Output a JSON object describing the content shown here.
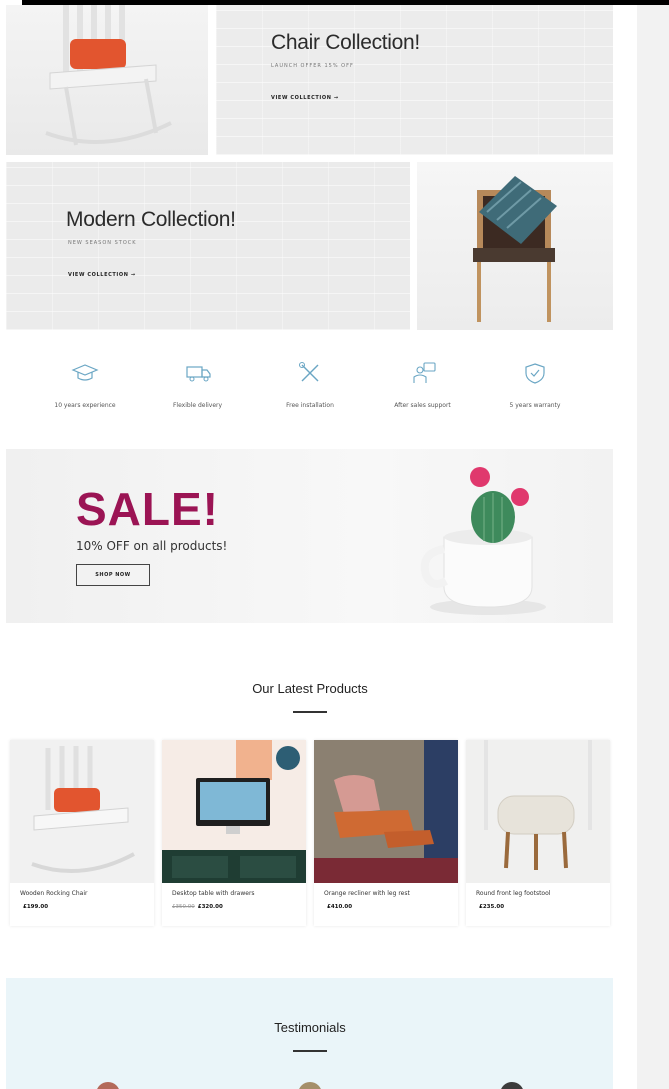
{
  "banners": {
    "chair": {
      "title": "Chair Collection!",
      "subtitle": "LAUNCH OFFER 15% OFF",
      "link": "VIEW COLLECTION"
    },
    "modern": {
      "title": "Modern Collection!",
      "subtitle": "NEW SEASON STOCK",
      "link": "VIEW COLLECTION"
    }
  },
  "features": [
    {
      "icon": "graduation-cap-icon",
      "label": "10 years experience"
    },
    {
      "icon": "truck-icon",
      "label": "Flexible delivery"
    },
    {
      "icon": "tools-icon",
      "label": "Free installation"
    },
    {
      "icon": "support-icon",
      "label": "After sales support"
    },
    {
      "icon": "shield-check-icon",
      "label": "5 years warranty"
    }
  ],
  "sale": {
    "title": "SALE!",
    "subtitle": "10% OFF on all products!",
    "button": "SHOP NOW"
  },
  "latest": {
    "title": "Our Latest Products",
    "products": [
      {
        "name": "Wooden Rocking Chair",
        "price": "£199.00",
        "old_price": ""
      },
      {
        "name": "Desktop table with drawers",
        "price": "£320.00",
        "old_price": "£350.00"
      },
      {
        "name": "Orange recliner with leg rest",
        "price": "£410.00",
        "old_price": ""
      },
      {
        "name": "Round front leg footstool",
        "price": "£235.00",
        "old_price": ""
      }
    ]
  },
  "testimonials": {
    "title": "Testimonials"
  },
  "colors": {
    "sale_accent": "#9b1454",
    "icon_stroke": "#6aa6c4",
    "badge": "#2d5e74",
    "testimonial_bg": "#eaf5f9"
  }
}
